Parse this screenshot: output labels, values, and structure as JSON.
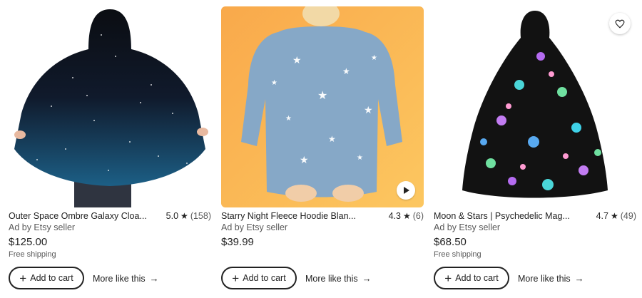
{
  "colors": {
    "text": "#222222",
    "muted": "#595959",
    "button_border": "#222222"
  },
  "listings": [
    {
      "title": "Outer Space Ombre Galaxy Cloa...",
      "rating": "5.0",
      "review_count": "(158)",
      "seller": "Ad by Etsy seller",
      "price": "$125.00",
      "shipping": "Free shipping",
      "add_to_cart": "Add to cart",
      "more_like_this": "More like this",
      "image_icon": "galaxy-cloak-image"
    },
    {
      "title": "Starry Night Fleece Hoodie Blan...",
      "rating": "4.3",
      "review_count": "(6)",
      "seller": "Ad by Etsy seller",
      "price": "$39.99",
      "shipping": "",
      "add_to_cart": "Add to cart",
      "more_like_this": "More like this",
      "image_icon": "starry-hoodie-image"
    },
    {
      "title": "Moon & Stars | Psychedelic Mag...",
      "rating": "4.7",
      "review_count": "(49)",
      "seller": "Ad by Etsy seller",
      "price": "$68.50",
      "shipping": "Free shipping",
      "add_to_cart": "Add to cart",
      "more_like_this": "More like this",
      "image_icon": "moon-stars-cloak-image"
    }
  ]
}
